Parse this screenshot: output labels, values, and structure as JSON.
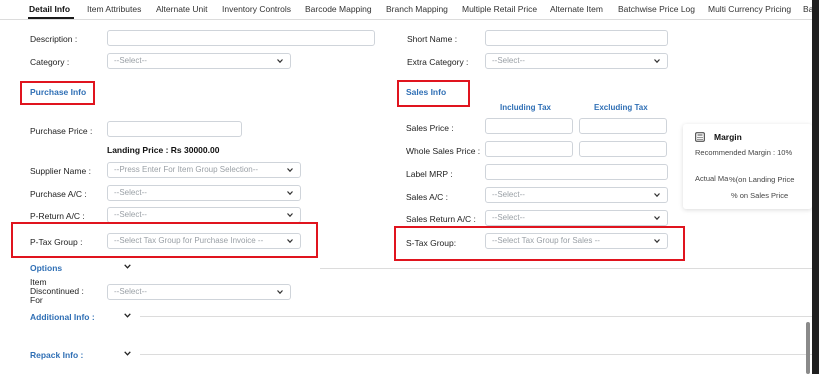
{
  "tabs": [
    {
      "label": "Detail Info",
      "active": true
    },
    {
      "label": "Item Attributes"
    },
    {
      "label": "Alternate Unit"
    },
    {
      "label": "Inventory Controls"
    },
    {
      "label": "Barcode Mapping"
    },
    {
      "label": "Branch Mapping"
    },
    {
      "label": "Multiple Retail Price"
    },
    {
      "label": "Alternate Item"
    },
    {
      "label": "Batchwise Price Log"
    },
    {
      "label": "Multi Currency Pricing"
    },
    {
      "label": "Ba"
    }
  ],
  "general": {
    "description_label": "Description :",
    "category_label": "Category :",
    "category_value": "--Select--",
    "short_name_label": "Short Name :",
    "extra_category_label": "Extra Category :",
    "extra_category_value": "--Select--"
  },
  "purchase": {
    "section_title": "Purchase Info",
    "price_label": "Purchase Price :",
    "landing_price": "Landing Price : Rs 30000.00",
    "supplier_label": "Supplier Name :",
    "supplier_placeholder": "--Press Enter For Item Group Selection--",
    "account_label": "Purchase A/C :",
    "account_value": "--Select--",
    "return_label": "P-Return A/C :",
    "return_value": "--Select--",
    "tax_label": "P-Tax Group :",
    "tax_value": "--Select Tax Group for Purchase Invoice --"
  },
  "sales": {
    "section_title": "Sales Info",
    "col_including": "Including Tax",
    "col_excluding": "Excluding Tax",
    "price_label": "Sales Price :",
    "whole_label": "Whole Sales Price :",
    "mrp_label": "Label MRP :",
    "account_label": "Sales A/C :",
    "account_value": "--Select--",
    "return_label": "Sales Return A/C :",
    "return_value": "--Select--",
    "tax_label": "S-Tax Group:",
    "tax_value": "--Select Tax Group for Sales --"
  },
  "margin": {
    "title": "Margin",
    "recommended": "Recommended Margin : 10%",
    "actual_prefix": "Actual Ma",
    "actual_overlap": "%(on Landing Price",
    "on_sales": "% on Sales Price"
  },
  "options": {
    "title": "Options",
    "discontinued_label": "Item Discontinued : For",
    "discontinued_value": "--Select--"
  },
  "additional": {
    "title": "Additional Info :"
  },
  "repack": {
    "title": "Repack  Info :"
  },
  "colors": {
    "accent": "#2f6fb5",
    "highlight": "#e0141e"
  }
}
